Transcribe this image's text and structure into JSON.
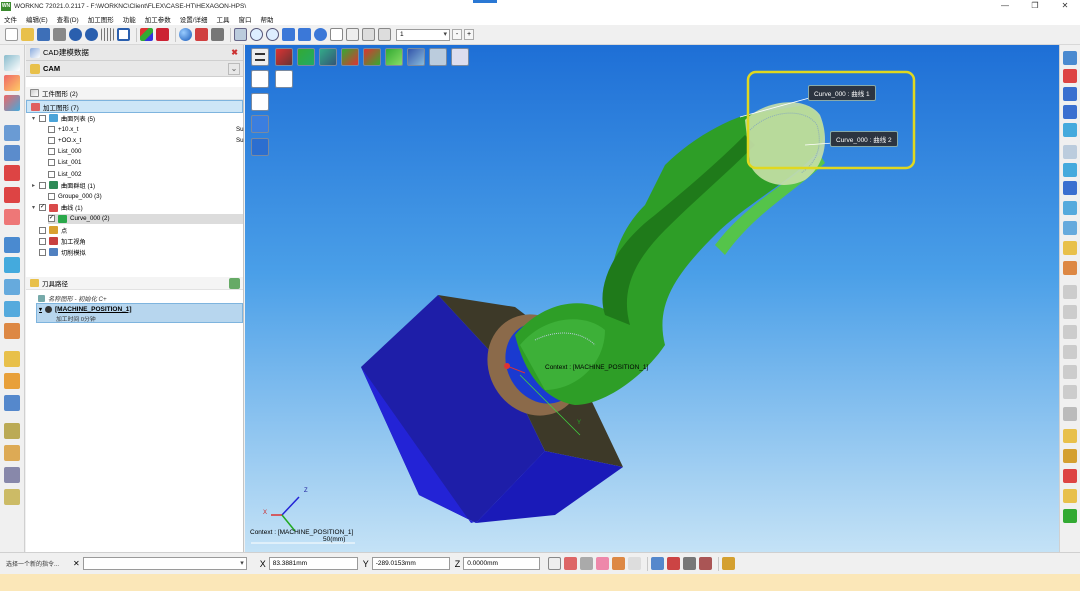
{
  "window": {
    "logo": "WN",
    "title": "WORKNC 72021.0.2117 - F:\\WORKNC\\Client\\FLEX\\CASE-HT\\HEXAGON-HPS\\",
    "minimize": "—",
    "maximize": "❐",
    "close": "✕"
  },
  "menu": [
    "文件",
    "编辑(E)",
    "查看(D)",
    "加工图形",
    "功能",
    "加工参数",
    "设置/详细",
    "工具",
    "窗口",
    "帮助"
  ],
  "toolbar": {
    "layer_value": "1",
    "minus": "-",
    "plus": "+",
    "icons": [
      "new-file",
      "open-folder",
      "save",
      "print",
      "undo",
      "redo",
      "grid",
      "frame",
      "axes",
      "axis-red",
      "sphere",
      "box-blue",
      "box-red",
      "zoom-window",
      "zoom-in",
      "zoom-out",
      "rotate",
      "pan",
      "refresh",
      "view-iso",
      "view-grid",
      "view-shade",
      "view-wire"
    ]
  },
  "panel": {
    "header": "CAD建模数据",
    "cam_label": "CAM",
    "sections": {
      "workpiece": "工件图形 (2)",
      "machining": "加工图形 (7)",
      "toolpath": "刀具路径"
    },
    "tree": [
      {
        "label": "曲面列表 (5)",
        "toggle": "▾",
        "checked": false,
        "level": 0,
        "icon": "surface-list-icon",
        "color": "#4aa3d8"
      },
      {
        "label": "+10.x_t",
        "level": 1,
        "suffix": "Su",
        "checked": false
      },
      {
        "label": "+OO.x_t",
        "level": 1,
        "suffix": "Su",
        "checked": false
      },
      {
        "label": "List_000",
        "level": 1,
        "checked": false
      },
      {
        "label": "List_001",
        "level": 1,
        "checked": false
      },
      {
        "label": "List_002",
        "level": 1,
        "checked": false
      },
      {
        "label": "曲面群组 (1)",
        "toggle": "▸",
        "checked": false,
        "level": 0,
        "icon": "surface-group-icon",
        "color": "#2e8b57"
      },
      {
        "label": "Groupe_000 (3)",
        "level": 1,
        "checked": false
      },
      {
        "label": "曲线 (1)",
        "toggle": "▾",
        "checked": true,
        "level": 0,
        "icon": "curve-icon",
        "color": "#d94a4a"
      },
      {
        "label": "Curve_000 (2)",
        "level": 1,
        "checked": true,
        "icon": "curve-item-icon",
        "color": "#2aa84a",
        "selected": true
      },
      {
        "label": "点",
        "level": 0,
        "checked": false,
        "icon": "point-icon",
        "color": "#d9a030"
      },
      {
        "label": "加工视角",
        "level": 0,
        "checked": false,
        "icon": "view-angle-icon",
        "color": "#c84040"
      },
      {
        "label": "切削模拟",
        "level": 0,
        "checked": false,
        "icon": "simulation-icon",
        "color": "#5080c0"
      }
    ],
    "toolpath_info": "名称图形 - 初始化  C+",
    "machine_position": "[MACHINE_POSITION_1]",
    "machine_sub": "加工时间 0分钟"
  },
  "viewport": {
    "labels": {
      "curve1": "Curve_000 : 曲线 1",
      "curve2": "Curve_000 : 曲线 2",
      "context_model": "Context : [MACHINE_POSITION_1]",
      "context_axis": "Context : [MACHINE_POSITION_1]",
      "scale": "50(mm)",
      "axis_x": "X",
      "axis_y": "Y",
      "axis_z": "Z"
    },
    "colors": {
      "stock": "#2323d6",
      "part": "#2e9e27",
      "highlight": "#e0d820"
    }
  },
  "bottom": {
    "cmd_label": "选择一个新的指令...",
    "x_label": "X",
    "x_value": "83.3881mm",
    "y_label": "Y",
    "y_value": "-289.0153mm",
    "z_label": "Z",
    "z_value": "0.0000mm"
  }
}
